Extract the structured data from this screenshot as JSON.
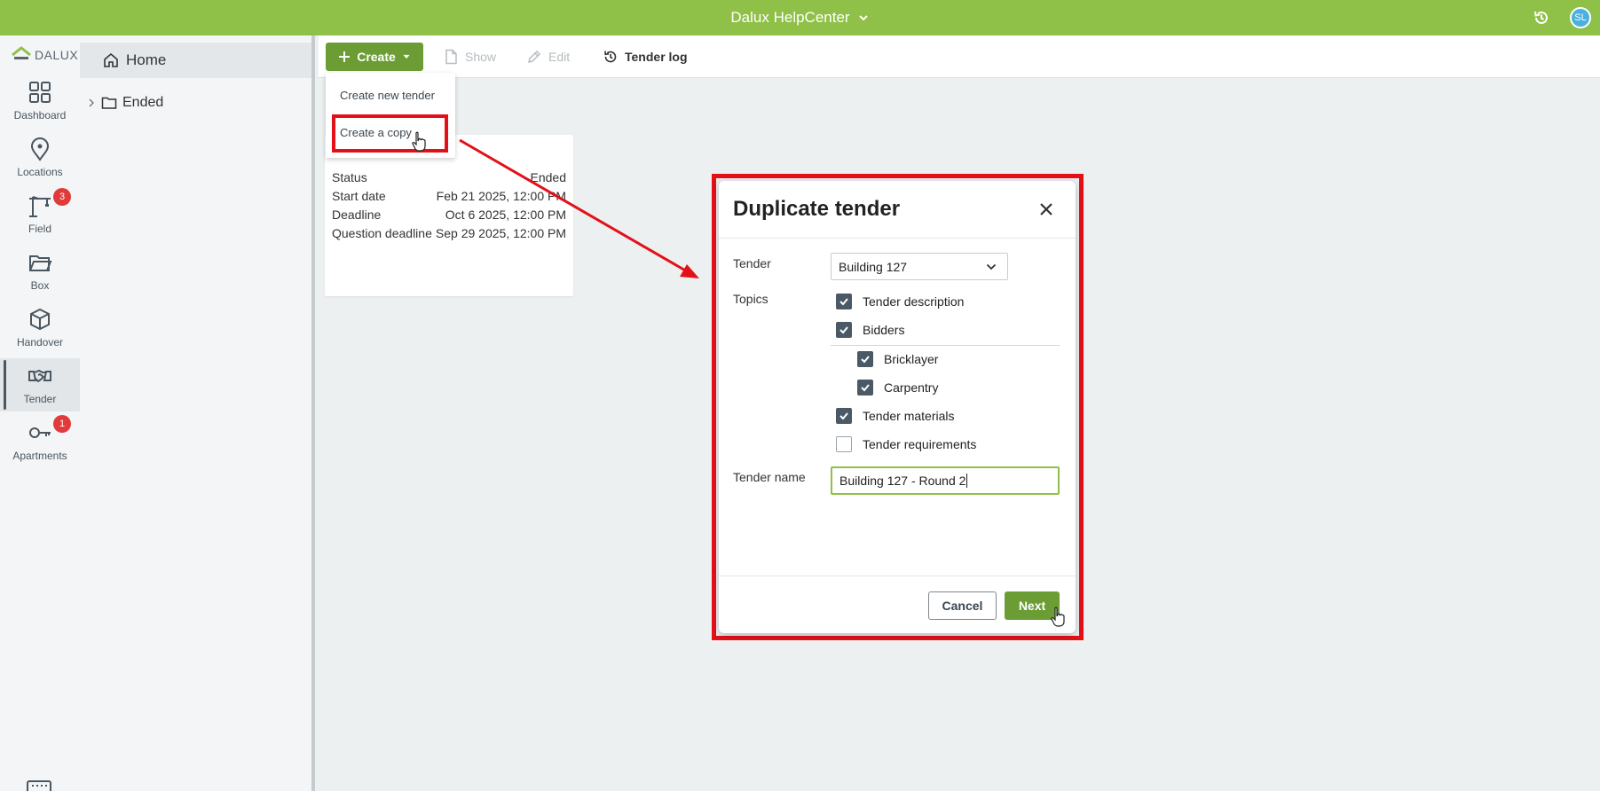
{
  "topbar": {
    "title": "Dalux HelpCenter",
    "avatar_initials": "SL"
  },
  "rail": {
    "logo": "DALUX",
    "items": [
      {
        "label": "Dashboard",
        "icon": "grid-icon"
      },
      {
        "label": "Locations",
        "icon": "location-pin-icon"
      },
      {
        "label": "Field",
        "icon": "crane-icon",
        "badge": "3"
      },
      {
        "label": "Box",
        "icon": "folder-open-icon"
      },
      {
        "label": "Handover",
        "icon": "cube-icon"
      },
      {
        "label": "Tender",
        "icon": "handshake-icon",
        "active": true
      },
      {
        "label": "Apartments",
        "icon": "key-icon",
        "badge": "1"
      }
    ]
  },
  "tree": {
    "home": "Home",
    "ended": "Ended"
  },
  "toolbar": {
    "create": "Create",
    "show": "Show",
    "edit": "Edit",
    "tender_log": "Tender log"
  },
  "create_menu": {
    "new_tender": "Create new tender",
    "copy": "Create a copy"
  },
  "card": {
    "rows": [
      {
        "label": "Status",
        "value": "Ended"
      },
      {
        "label": "Start date",
        "value": "Feb 21 2025, 12:00 PM"
      },
      {
        "label": "Deadline",
        "value": "Oct 6 2025, 12:00 PM"
      },
      {
        "label": "Question deadline",
        "value": "Sep 29 2025, 12:00 PM"
      }
    ]
  },
  "dialog": {
    "title": "Duplicate tender",
    "tender_label": "Tender",
    "tender_value": "Building 127",
    "topics_label": "Topics",
    "topics": [
      {
        "label": "Tender description",
        "checked": true
      },
      {
        "label": "Bidders",
        "checked": true
      },
      {
        "label": "Bricklayer",
        "checked": true
      },
      {
        "label": "Carpentry",
        "checked": true
      },
      {
        "label": "Tender materials",
        "checked": true
      },
      {
        "label": "Tender requirements",
        "checked": false
      }
    ],
    "name_label": "Tender name",
    "name_value": "Building 127 - Round 2",
    "cancel": "Cancel",
    "next": "Next"
  },
  "colors": {
    "brand_green": "#8fc047",
    "button_green": "#6b9d34",
    "highlight_red": "#e31018",
    "badge_red": "#e03a3a"
  }
}
